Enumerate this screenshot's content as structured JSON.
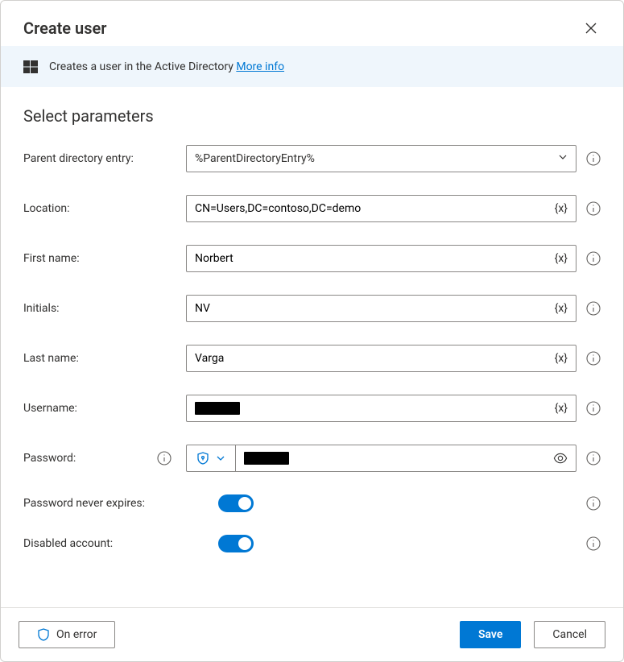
{
  "dialog": {
    "title": "Create user"
  },
  "banner": {
    "icon": "windows-icon",
    "text": "Creates a user in the Active Directory",
    "link_label": "More info"
  },
  "section": {
    "title": "Select parameters"
  },
  "fields": {
    "parent_directory_entry": {
      "label": "Parent directory entry:",
      "value": "%ParentDirectoryEntry%"
    },
    "location": {
      "label": "Location:",
      "value": "CN=Users,DC=contoso,DC=demo",
      "variable_suffix": "{x}"
    },
    "first_name": {
      "label": "First name:",
      "value": "Norbert",
      "variable_suffix": "{x}"
    },
    "initials": {
      "label": "Initials:",
      "value": "NV",
      "variable_suffix": "{x}"
    },
    "last_name": {
      "label": "Last name:",
      "value": "Varga",
      "variable_suffix": "{x}"
    },
    "username": {
      "label": "Username:",
      "value_redacted": true,
      "variable_suffix": "{x}"
    },
    "password": {
      "label": "Password:",
      "value_redacted": true
    },
    "password_never_expires": {
      "label": "Password never expires:",
      "value": true
    },
    "disabled_account": {
      "label": "Disabled account:",
      "value": true
    }
  },
  "footer": {
    "on_error": "On error",
    "save": "Save",
    "cancel": "Cancel"
  }
}
